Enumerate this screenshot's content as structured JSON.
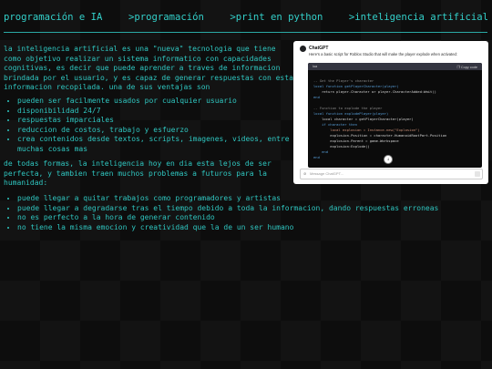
{
  "nav": {
    "items": [
      "programación e IA",
      ">programación",
      ">print en python",
      ">inteligencia artificial"
    ]
  },
  "intro": "la inteligencia artificial es una \"nueva\" tecnologia que tiene como objetivo realizar un sistema informatico con capacidades cognitivas, es decir que puede aprender a traves de informacion brindada por el usuario, y es capaz de generar respuestas con esta informacion recopilada. una de sus ventajas son",
  "advantages": [
    "pueden ser facilmente usados por cualquier usuario",
    "disponibilidad 24/7",
    "respuestas imparciales",
    "reduccion de costos, trabajo y esfuerzo",
    "crea contenidos desde textos, scripts, imagenes, videos, entre muchas cosas mas"
  ],
  "para2": "de todas formas, la inteligencia hoy en dia esta lejos de ser perfecta, y tambien traen muchos problemas a futuros para la humanidad:",
  "problems": [
    "puede llegar a quitar trabajos como programadores y artistas",
    "puede llegar a degradarse tras el tiempo debido a toda la informacion, dando respuestas erroneas",
    "no es perfecto a la hora de generar contenido",
    "no tiene la misma emocion y creatividad que la de un ser humano"
  ],
  "chatgpt": {
    "name": "ChatGPT",
    "message": "Here's a basic script for Roblox Studio that will make the player explode when activated:",
    "code_lang": "lua",
    "copy_label": "Copy code",
    "code_lines": [
      "-- Get the Player's character",
      "local function getPlayerCharacter(player)",
      "    return player.Character or player.CharacterAdded:Wait()",
      "end",
      "",
      "-- Function to explode the player",
      "local function explodePlayer(player)",
      "    local character = getPlayerCharacter(player)",
      "    if character then",
      "        local explosion = Instance.new(\"Explosion\")",
      "        explosion.Position = character.HumanoidRootPart.Position",
      "        explosion.Parent = game.Workspace",
      "        explosion:Explode()",
      "    end",
      "end"
    ],
    "input_placeholder": "Message ChatGPT..."
  },
  "colors": {
    "accent": "#2fc6c0",
    "background": "#0d0d0d"
  },
  "icons": [
    "chatgpt-logo-icon",
    "copy-icon",
    "arrow-down-icon",
    "attach-icon",
    "send-icon"
  ]
}
